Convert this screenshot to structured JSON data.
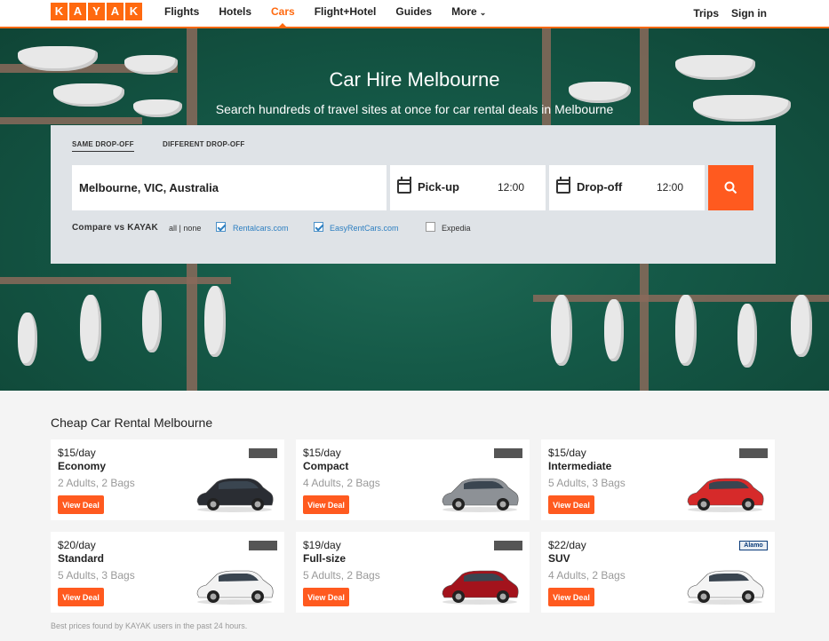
{
  "header": {
    "logo_letters": [
      "K",
      "A",
      "Y",
      "A",
      "K"
    ],
    "nav": [
      {
        "label": "Flights"
      },
      {
        "label": "Hotels"
      },
      {
        "label": "Cars",
        "active": true
      },
      {
        "label": "Flight+Hotel"
      },
      {
        "label": "Guides"
      },
      {
        "label": "More"
      }
    ],
    "trips": "Trips",
    "signin": "Sign in"
  },
  "hero": {
    "title": "Car Hire Melbourne",
    "subtitle": "Search hundreds of travel sites at once for car rental deals in Melbourne"
  },
  "search": {
    "tab_same": "SAME DROP-OFF",
    "tab_diff": "DIFFERENT DROP-OFF",
    "location": "Melbourne, VIC, Australia",
    "pickup_label": "Pick-up",
    "pickup_time": "12:00",
    "dropoff_label": "Drop-off",
    "dropoff_time": "12:00",
    "compare_label": "Compare vs KAYAK",
    "allnone": "all | none",
    "providers": [
      {
        "name": "Rentalcars.com",
        "checked": true
      },
      {
        "name": "EasyRentCars.com",
        "checked": true
      },
      {
        "name": "Expedia",
        "checked": false
      }
    ]
  },
  "results": {
    "title": "Cheap Car Rental Melbourne",
    "deal_label": "View Deal",
    "cards": [
      {
        "price": "$15/day",
        "type": "Economy",
        "capacity": "2 Adults, 2 Bags",
        "car_color": "#2a2d33"
      },
      {
        "price": "$15/day",
        "type": "Compact",
        "capacity": "4 Adults, 2 Bags",
        "car_color": "#8d9196"
      },
      {
        "price": "$15/day",
        "type": "Intermediate",
        "capacity": "5 Adults, 3 Bags",
        "car_color": "#d62a2a"
      },
      {
        "price": "$20/day",
        "type": "Standard",
        "capacity": "5 Adults, 3 Bags",
        "car_color": "#f2f2f2"
      },
      {
        "price": "$19/day",
        "type": "Full-size",
        "capacity": "5 Adults, 2 Bags",
        "car_color": "#a3131c"
      },
      {
        "price": "$22/day",
        "type": "SUV",
        "capacity": "4 Adults, 2 Bags",
        "car_color": "#f4f4f4",
        "logo": "Alamo"
      }
    ],
    "footnote": "Best prices found by KAYAK users in the past 24 hours."
  },
  "colors": {
    "accent": "#ff690f",
    "link": "#2d7fc1"
  }
}
